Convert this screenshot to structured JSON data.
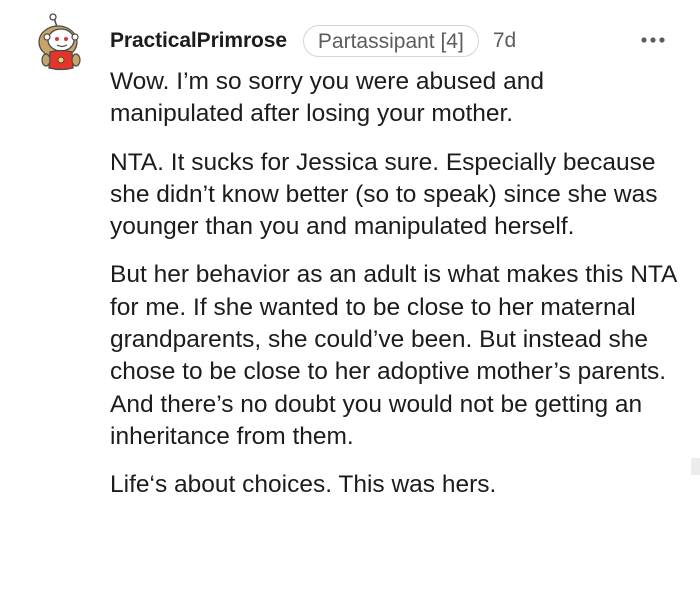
{
  "comment": {
    "username": "PracticalPrimrose",
    "flair": "Partassipant [4]",
    "age": "7d",
    "paragraphs": [
      "Wow. I’m so sorry you were abused and manipulated after losing your mother.",
      "NTA. It sucks for Jessica sure. Especially because she didn’t know better (so to speak) since she was younger than you and manipulated herself.",
      "But her behavior as an adult is what makes this NTA for me. If she wanted to be close to her maternal grandparents, she could’ve been. But instead she chose to be close to her adoptive mother’s parents. And there’s no doubt you would not be getting an inheritance from them.",
      "Life‘s about choices. This was hers."
    ]
  },
  "icons": {
    "avatar": "snoo-avatar-icon",
    "more": "more-horizontal-icon"
  },
  "colors": {
    "text": "#1c1c1c",
    "meta": "#5c5c5c",
    "flair_border": "#d5d5d5",
    "avatar_shirt": "#e5352b"
  }
}
